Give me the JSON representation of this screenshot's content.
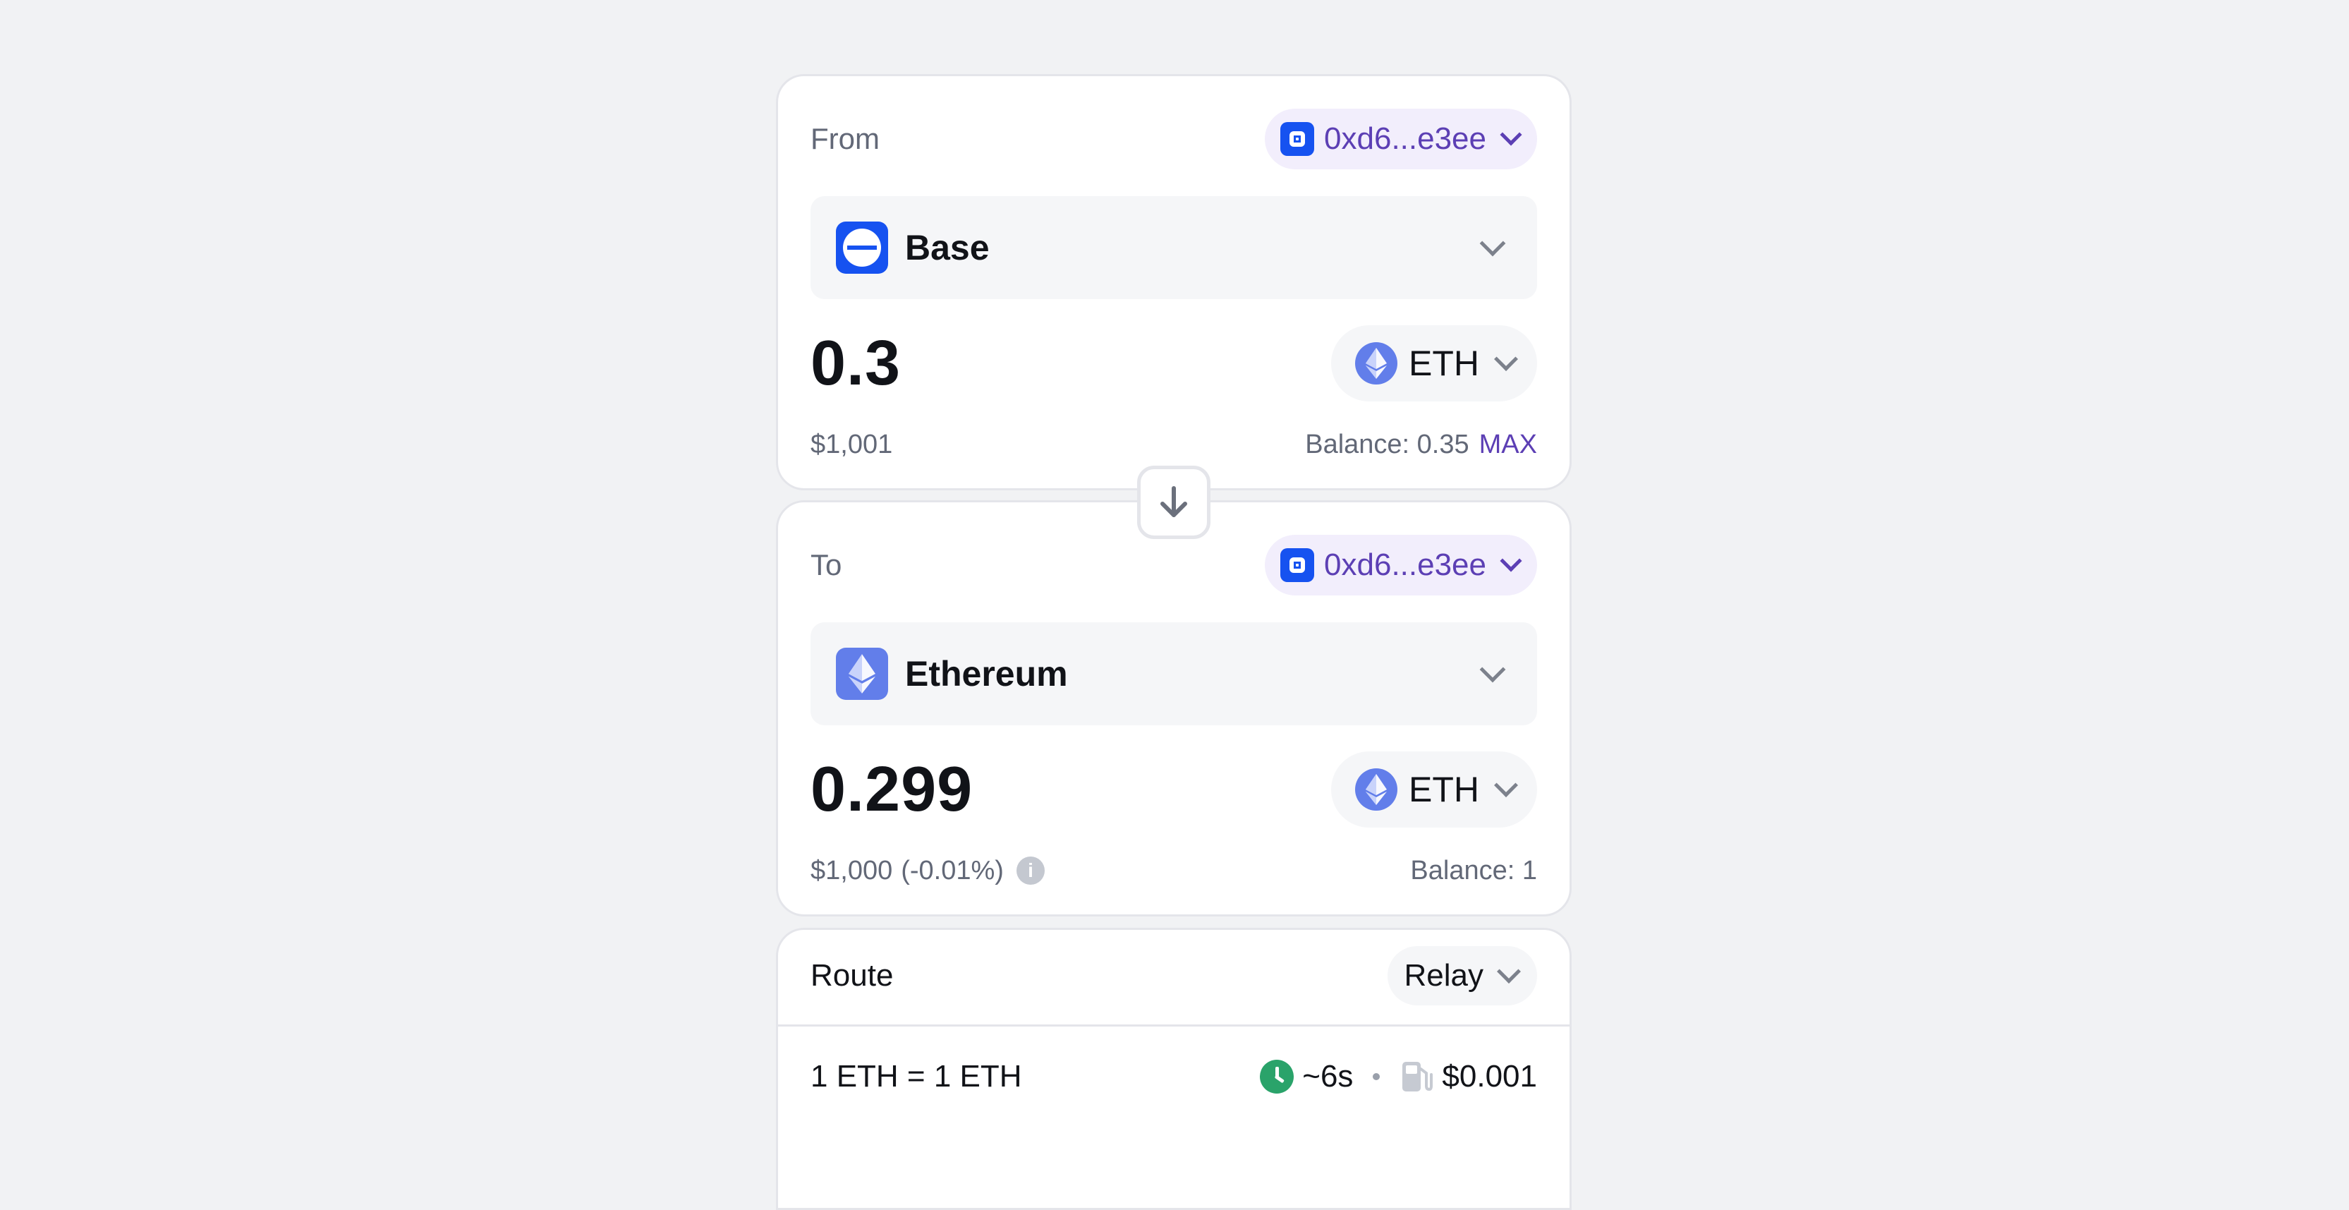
{
  "from": {
    "label": "From",
    "wallet": "0xd6...e3ee",
    "chain": "Base",
    "amount": "0.3",
    "token": "ETH",
    "usd_value": "$1,001",
    "balance": "Balance: 0.35",
    "max_label": "MAX"
  },
  "to": {
    "label": "To",
    "wallet": "0xd6...e3ee",
    "chain": "Ethereum",
    "amount": "0.299",
    "token": "ETH",
    "usd_value": "$1,000",
    "price_impact": "(-0.01%)",
    "balance": "Balance: 1"
  },
  "route": {
    "label": "Route",
    "provider": "Relay",
    "rate": "1 ETH = 1 ETH",
    "time": "~6s",
    "gas": "$0.001"
  },
  "colors": {
    "accent": "#5c3fb4",
    "wallet_pill_bg": "#f2eefc",
    "base_blue": "#1652f0",
    "eth_purple": "#627eea",
    "success_green": "#2aa36a"
  },
  "icons": {
    "wallet": "coinbase-wallet-icon",
    "base_chain": "base-chain-icon",
    "eth_chain": "ethereum-chain-icon",
    "token": "eth-token-icon",
    "swap": "arrow-down-icon",
    "info": "info-icon",
    "time": "clock-icon",
    "gas": "gas-pump-icon"
  }
}
